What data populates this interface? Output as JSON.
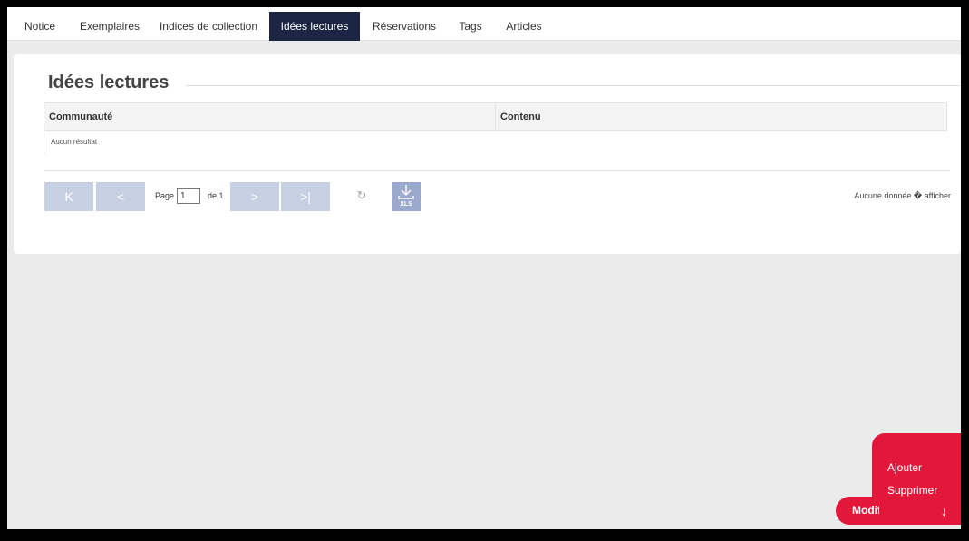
{
  "tabs": [
    {
      "label": "Notice"
    },
    {
      "label": "Exemplaires"
    },
    {
      "label": "Indices de collection"
    },
    {
      "label": "Idées lectures",
      "active": true
    },
    {
      "label": "Réservations"
    },
    {
      "label": "Tags"
    },
    {
      "label": "Articles"
    }
  ],
  "section": {
    "title": "Idées lectures"
  },
  "grid": {
    "columns": [
      "Communauté",
      "Contenu"
    ],
    "empty_text": "Aucun résultat"
  },
  "pager": {
    "page_label": "Page",
    "page_value": "1",
    "of_label": "de 1",
    "export_label": "XLS",
    "info": "Aucune donnée � afficher"
  },
  "actions": {
    "add_label": "Ajouter",
    "delete_label": "Supprimer",
    "main_label": "Modifier"
  },
  "colors": {
    "tab_active": "#1c2544",
    "accent": "#e3173a",
    "pager_button": "#c7d0e3"
  }
}
